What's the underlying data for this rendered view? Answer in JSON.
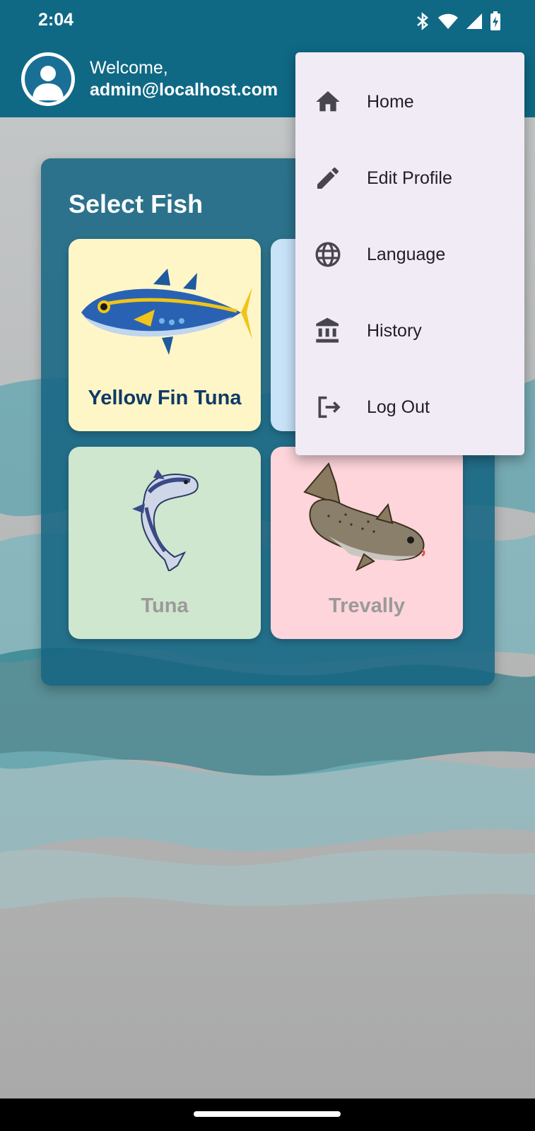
{
  "status_bar": {
    "time": "2:04",
    "icons": [
      "bluetooth-icon",
      "wifi-icon",
      "signal-icon",
      "battery-charging-icon"
    ]
  },
  "header": {
    "greeting": "Welcome,",
    "email": "admin@localhost.com",
    "avatar_icon": "person-icon"
  },
  "main": {
    "title": "Select Fish",
    "fish": [
      {
        "label": "Yellow Fin Tuna",
        "bg": "#fff6c7",
        "text_color": "#0f3a66"
      },
      {
        "label": "",
        "bg": "#c8e2f8",
        "text_color": "#0f3a66"
      },
      {
        "label": "Tuna",
        "bg": "#cfe6cf",
        "text_color": "#9a9a9a"
      },
      {
        "label": "Trevally",
        "bg": "#fdd5db",
        "text_color": "#9a9a9a"
      }
    ]
  },
  "menu": {
    "items": [
      {
        "label": "Home",
        "icon": "home-icon"
      },
      {
        "label": "Edit Profile",
        "icon": "pencil-icon"
      },
      {
        "label": "Language",
        "icon": "globe-icon"
      },
      {
        "label": "History",
        "icon": "bank-icon"
      },
      {
        "label": "Log Out",
        "icon": "logout-icon"
      }
    ]
  },
  "colors": {
    "primary": "#0f6985",
    "menu_bg": "#f1ebf6",
    "card_bg": "#14647f"
  }
}
